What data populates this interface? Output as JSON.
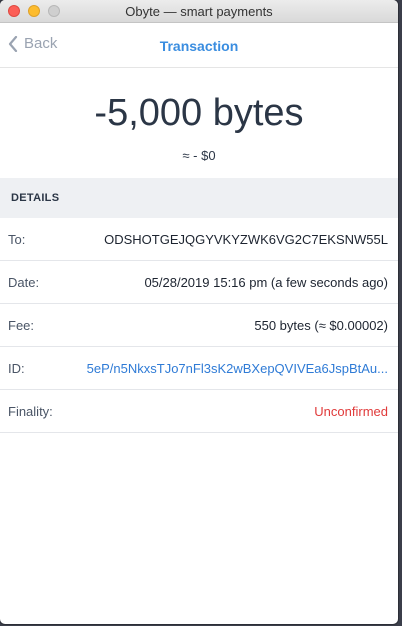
{
  "window": {
    "title": "Obyte — smart payments"
  },
  "nav": {
    "back_label": "Back",
    "title": "Transaction"
  },
  "amount": {
    "value": "-5,000 bytes",
    "fiat": "≈ - $0"
  },
  "details": {
    "heading": "DETAILS",
    "rows": [
      {
        "label": "To:",
        "value": "ODSHOTGEJQGYVKYZWK6VG2C7EKSNW55L"
      },
      {
        "label": "Date:",
        "value": "05/28/2019 15:16 pm (a few seconds ago)"
      },
      {
        "label": "Fee:",
        "value": "550 bytes (≈ $0.00002)"
      },
      {
        "label": "ID:",
        "value": "5eP/n5NkxsTJo7nFl3sK2wBXepQVIVEa6JspBtAu..."
      },
      {
        "label": "Finality:",
        "value": "Unconfirmed"
      }
    ]
  },
  "colors": {
    "accent": "#3a8de0",
    "link": "#2f7bd6",
    "warning": "#e03a3a",
    "section_bg": "#eef0f3"
  },
  "icons": {
    "back": "chevron-left-icon"
  }
}
